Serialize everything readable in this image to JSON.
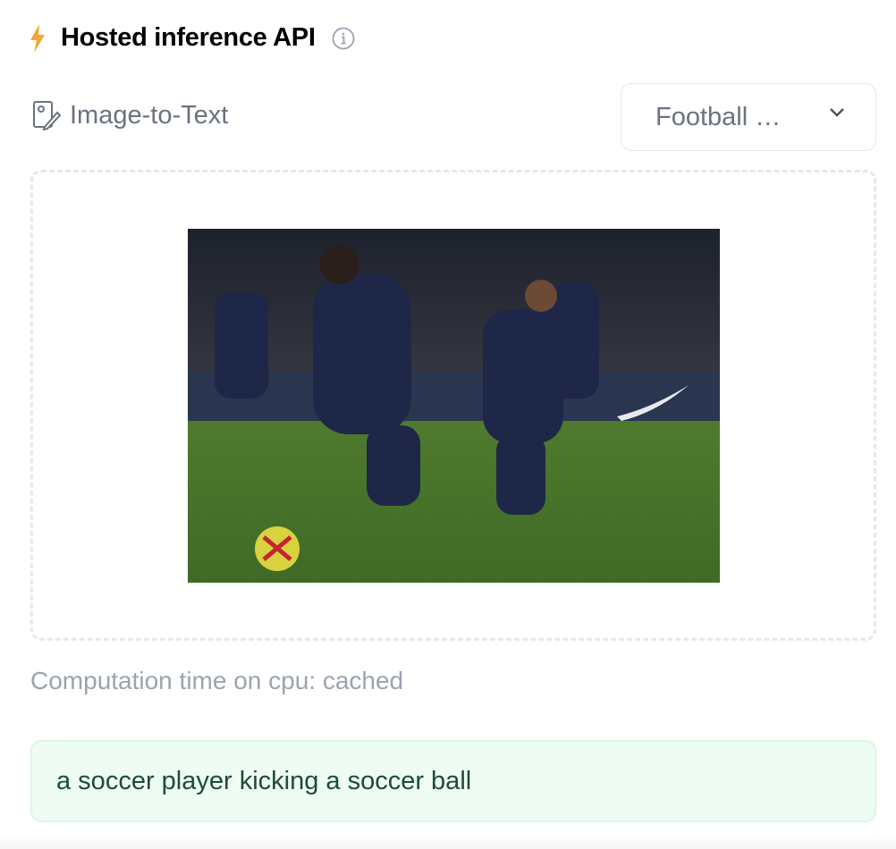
{
  "header": {
    "title": "Hosted inference API",
    "bolt_icon": "lightning-bolt-icon",
    "bolt_color": "#f2a735",
    "info_icon": "info-icon"
  },
  "task": {
    "label": "Image-to-Text",
    "icon": "image-settings-icon"
  },
  "model_select": {
    "value": "Football …",
    "icon": "chevron-down-icon"
  },
  "input_image": {
    "alt": "football players on pitch"
  },
  "computation": {
    "text": "Computation time on cpu: cached"
  },
  "output": {
    "text": "a soccer player kicking a soccer ball",
    "bg_color": "#effcf4",
    "text_color": "#1a4d35"
  }
}
